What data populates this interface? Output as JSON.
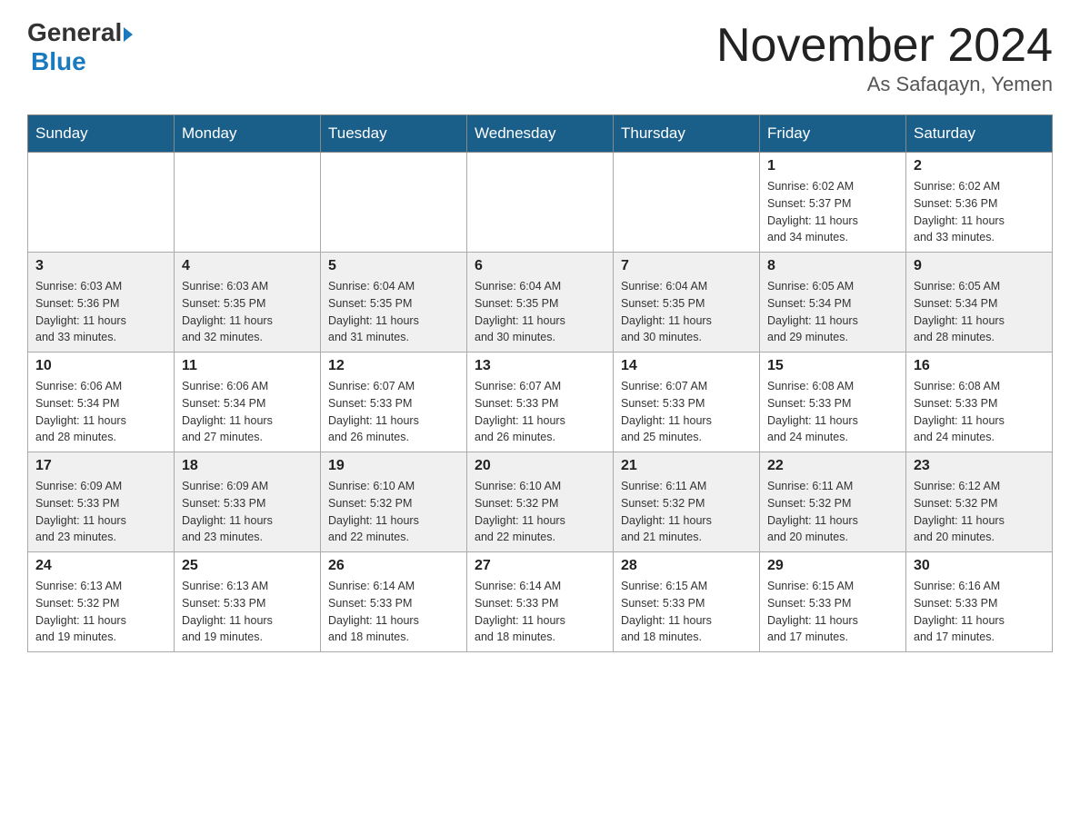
{
  "header": {
    "logo_general": "General",
    "logo_blue": "Blue",
    "month_title": "November 2024",
    "subtitle": "As Safaqayn, Yemen"
  },
  "calendar": {
    "days_of_week": [
      "Sunday",
      "Monday",
      "Tuesday",
      "Wednesday",
      "Thursday",
      "Friday",
      "Saturday"
    ],
    "weeks": [
      [
        {
          "day": "",
          "info": ""
        },
        {
          "day": "",
          "info": ""
        },
        {
          "day": "",
          "info": ""
        },
        {
          "day": "",
          "info": ""
        },
        {
          "day": "",
          "info": ""
        },
        {
          "day": "1",
          "info": "Sunrise: 6:02 AM\nSunset: 5:37 PM\nDaylight: 11 hours\nand 34 minutes."
        },
        {
          "day": "2",
          "info": "Sunrise: 6:02 AM\nSunset: 5:36 PM\nDaylight: 11 hours\nand 33 minutes."
        }
      ],
      [
        {
          "day": "3",
          "info": "Sunrise: 6:03 AM\nSunset: 5:36 PM\nDaylight: 11 hours\nand 33 minutes."
        },
        {
          "day": "4",
          "info": "Sunrise: 6:03 AM\nSunset: 5:35 PM\nDaylight: 11 hours\nand 32 minutes."
        },
        {
          "day": "5",
          "info": "Sunrise: 6:04 AM\nSunset: 5:35 PM\nDaylight: 11 hours\nand 31 minutes."
        },
        {
          "day": "6",
          "info": "Sunrise: 6:04 AM\nSunset: 5:35 PM\nDaylight: 11 hours\nand 30 minutes."
        },
        {
          "day": "7",
          "info": "Sunrise: 6:04 AM\nSunset: 5:35 PM\nDaylight: 11 hours\nand 30 minutes."
        },
        {
          "day": "8",
          "info": "Sunrise: 6:05 AM\nSunset: 5:34 PM\nDaylight: 11 hours\nand 29 minutes."
        },
        {
          "day": "9",
          "info": "Sunrise: 6:05 AM\nSunset: 5:34 PM\nDaylight: 11 hours\nand 28 minutes."
        }
      ],
      [
        {
          "day": "10",
          "info": "Sunrise: 6:06 AM\nSunset: 5:34 PM\nDaylight: 11 hours\nand 28 minutes."
        },
        {
          "day": "11",
          "info": "Sunrise: 6:06 AM\nSunset: 5:34 PM\nDaylight: 11 hours\nand 27 minutes."
        },
        {
          "day": "12",
          "info": "Sunrise: 6:07 AM\nSunset: 5:33 PM\nDaylight: 11 hours\nand 26 minutes."
        },
        {
          "day": "13",
          "info": "Sunrise: 6:07 AM\nSunset: 5:33 PM\nDaylight: 11 hours\nand 26 minutes."
        },
        {
          "day": "14",
          "info": "Sunrise: 6:07 AM\nSunset: 5:33 PM\nDaylight: 11 hours\nand 25 minutes."
        },
        {
          "day": "15",
          "info": "Sunrise: 6:08 AM\nSunset: 5:33 PM\nDaylight: 11 hours\nand 24 minutes."
        },
        {
          "day": "16",
          "info": "Sunrise: 6:08 AM\nSunset: 5:33 PM\nDaylight: 11 hours\nand 24 minutes."
        }
      ],
      [
        {
          "day": "17",
          "info": "Sunrise: 6:09 AM\nSunset: 5:33 PM\nDaylight: 11 hours\nand 23 minutes."
        },
        {
          "day": "18",
          "info": "Sunrise: 6:09 AM\nSunset: 5:33 PM\nDaylight: 11 hours\nand 23 minutes."
        },
        {
          "day": "19",
          "info": "Sunrise: 6:10 AM\nSunset: 5:32 PM\nDaylight: 11 hours\nand 22 minutes."
        },
        {
          "day": "20",
          "info": "Sunrise: 6:10 AM\nSunset: 5:32 PM\nDaylight: 11 hours\nand 22 minutes."
        },
        {
          "day": "21",
          "info": "Sunrise: 6:11 AM\nSunset: 5:32 PM\nDaylight: 11 hours\nand 21 minutes."
        },
        {
          "day": "22",
          "info": "Sunrise: 6:11 AM\nSunset: 5:32 PM\nDaylight: 11 hours\nand 20 minutes."
        },
        {
          "day": "23",
          "info": "Sunrise: 6:12 AM\nSunset: 5:32 PM\nDaylight: 11 hours\nand 20 minutes."
        }
      ],
      [
        {
          "day": "24",
          "info": "Sunrise: 6:13 AM\nSunset: 5:32 PM\nDaylight: 11 hours\nand 19 minutes."
        },
        {
          "day": "25",
          "info": "Sunrise: 6:13 AM\nSunset: 5:33 PM\nDaylight: 11 hours\nand 19 minutes."
        },
        {
          "day": "26",
          "info": "Sunrise: 6:14 AM\nSunset: 5:33 PM\nDaylight: 11 hours\nand 18 minutes."
        },
        {
          "day": "27",
          "info": "Sunrise: 6:14 AM\nSunset: 5:33 PM\nDaylight: 11 hours\nand 18 minutes."
        },
        {
          "day": "28",
          "info": "Sunrise: 6:15 AM\nSunset: 5:33 PM\nDaylight: 11 hours\nand 18 minutes."
        },
        {
          "day": "29",
          "info": "Sunrise: 6:15 AM\nSunset: 5:33 PM\nDaylight: 11 hours\nand 17 minutes."
        },
        {
          "day": "30",
          "info": "Sunrise: 6:16 AM\nSunset: 5:33 PM\nDaylight: 11 hours\nand 17 minutes."
        }
      ]
    ]
  }
}
